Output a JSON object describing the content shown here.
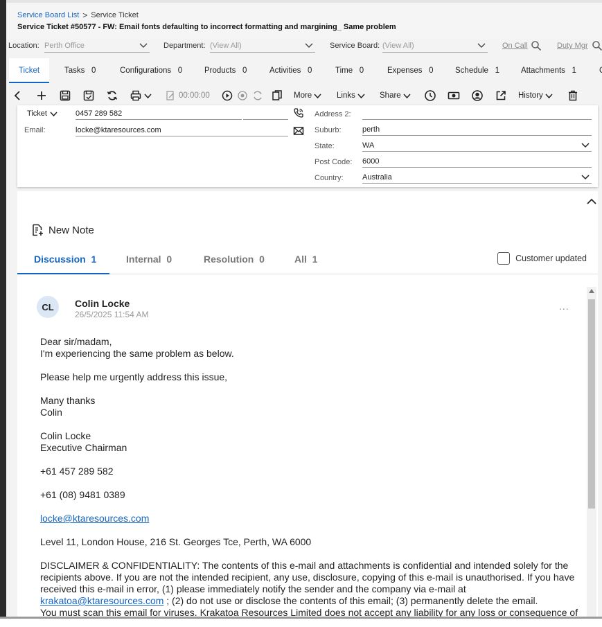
{
  "breadcrumb": {
    "parent": "Service Board List",
    "separator": ">",
    "current": "Service Ticket"
  },
  "page_title": "Service Ticket #50577 - FW: Email fonts defaulting to incorrect formatting and margining_ Same problem",
  "filters": {
    "location_label": "Location:",
    "location_value": "Perth Office",
    "department_label": "Department:",
    "department_value": "(View All)",
    "board_label": "Service Board:",
    "board_value": "(View All)",
    "on_call": "On Call",
    "duty_mgr": "Duty Mgr"
  },
  "tabs": [
    {
      "label": "Ticket"
    },
    {
      "label": "Tasks",
      "count": "0"
    },
    {
      "label": "Configurations",
      "count": "0"
    },
    {
      "label": "Products",
      "count": "0"
    },
    {
      "label": "Activities",
      "count": "0"
    },
    {
      "label": "Time",
      "count": "0"
    },
    {
      "label": "Expenses",
      "count": "0"
    },
    {
      "label": "Schedule",
      "count": "1"
    },
    {
      "label": "Attachments",
      "count": "1"
    },
    {
      "label": "C"
    }
  ],
  "toolbar": {
    "timer": "00:00:00",
    "more": "More",
    "links": "Links",
    "share": "Share",
    "history": "History"
  },
  "contact": {
    "phone_type": "Ticket",
    "phone": "0457 289 582",
    "email_label": "Email:",
    "email": "locke@ktaresources.com",
    "address2_label": "Address 2:",
    "address2": "",
    "suburb_label": "Suburb:",
    "suburb": "perth",
    "state_label": "State:",
    "state": "WA",
    "postcode_label": "Post Code:",
    "postcode": "6000",
    "country_label": "Country:",
    "country": "Australia"
  },
  "notes": {
    "new_note": "New Note",
    "tabs": [
      {
        "label": "Discussion",
        "count": "1"
      },
      {
        "label": "Internal",
        "count": "0"
      },
      {
        "label": "Resolution",
        "count": "0"
      },
      {
        "label": "All",
        "count": "1"
      }
    ],
    "customer_updated": "Customer updated",
    "entry": {
      "initials": "CL",
      "author": "Colin Locke",
      "date": "26/5/2025 11:54 AM",
      "menu": "...",
      "lines": [
        "Dear sir/madam,",
        "I'm experiencing the same problem as below.",
        "Please help me urgently address this issue,",
        "Many thanks",
        "Colin",
        "Colin Locke",
        "Executive Chairman",
        "+61 457 289 582",
        "+61 (08) 9481 0389",
        "locke@ktaresources.com",
        "Level 11, London House, 216 St. Georges Tce, Perth, WA 6000"
      ],
      "disclaimer_a": "DISCLAIMER & CONFIDENTIALITY: The contents of this e-mail and attachments is confidential and intended solely for the recipients above. If you are not the intended recipient, any use, disclosure, copying of this e-mail is unauthorised. If you have received this e-mail in error, (1) please immediately notify the sender and the company via e-mail at",
      "disclaimer_link": "krakatoa@ktaresources.com",
      "disclaimer_b": " ; (2) do not use or disclose the contents of this email; (3) permanently delete the email.",
      "disclaimer_c": "You must scan this email for viruses. Krakatoa Resources Limited does not accept any liability for any loss or consequence of"
    }
  },
  "colors": {
    "accent": "#1565c0",
    "tab_background": "#f3f3f3",
    "muted_text": "#999999"
  }
}
